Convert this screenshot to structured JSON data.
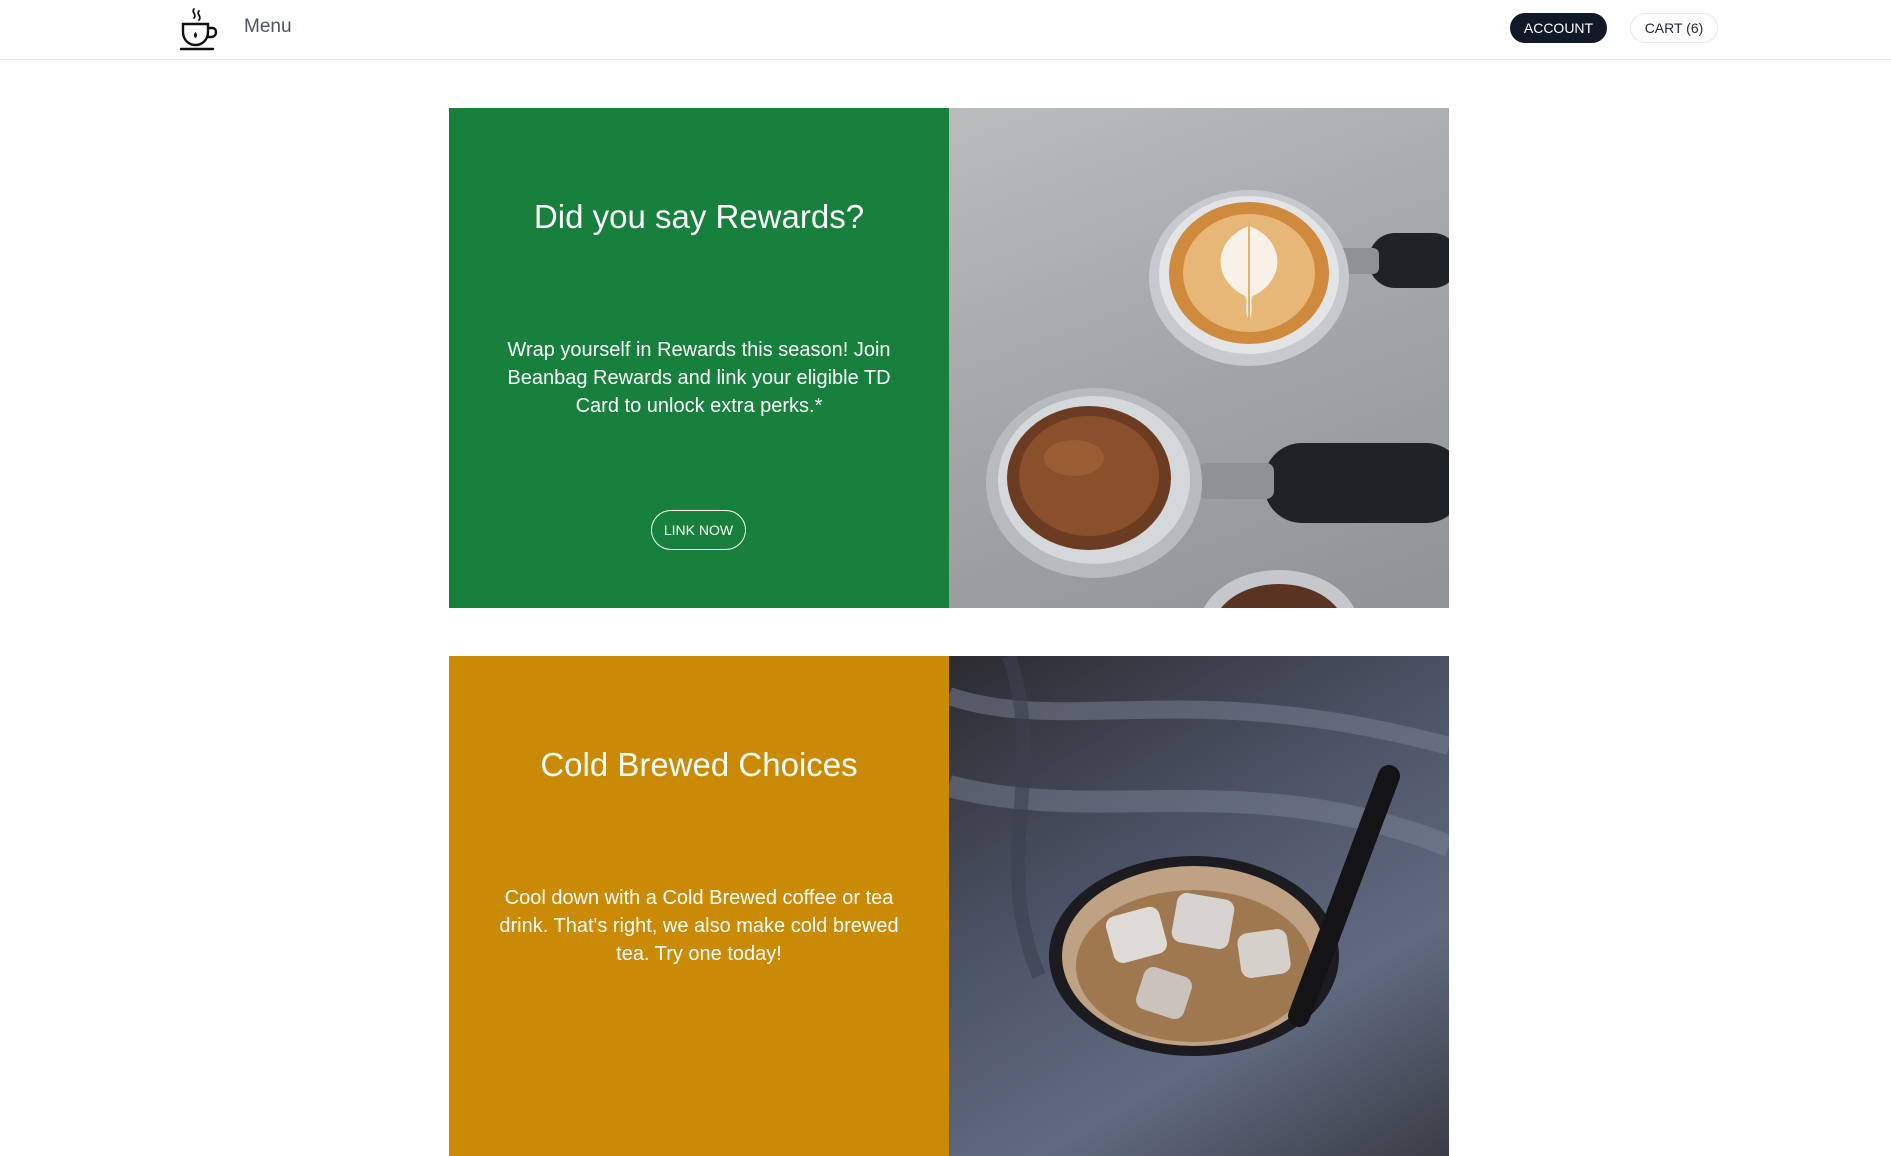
{
  "header": {
    "logo_icon": "coffee-cup-icon",
    "menu_label": "Menu",
    "account_label": "ACCOUNT",
    "cart_label": "CART (6)"
  },
  "promos": [
    {
      "title": "Did you say Rewards?",
      "body": "Wrap yourself in Rewards this season! Join Beanbag Rewards and link your eligible TD Card to unlock extra perks.*",
      "cta_label": "LINK NOW",
      "panel_color": "#16803c",
      "image": "espresso-portafilters-photo"
    },
    {
      "title": "Cold Brewed Choices",
      "body": "Cool down with a Cold Brewed coffee or tea drink. That's right, we also make cold brewed tea. Try one today!",
      "panel_color": "#ca8a04",
      "image": "iced-coffee-photo"
    }
  ],
  "colors": {
    "account_button": "#111827",
    "rewards_panel": "#16803c",
    "cold_brew_panel": "#ca8a04"
  }
}
